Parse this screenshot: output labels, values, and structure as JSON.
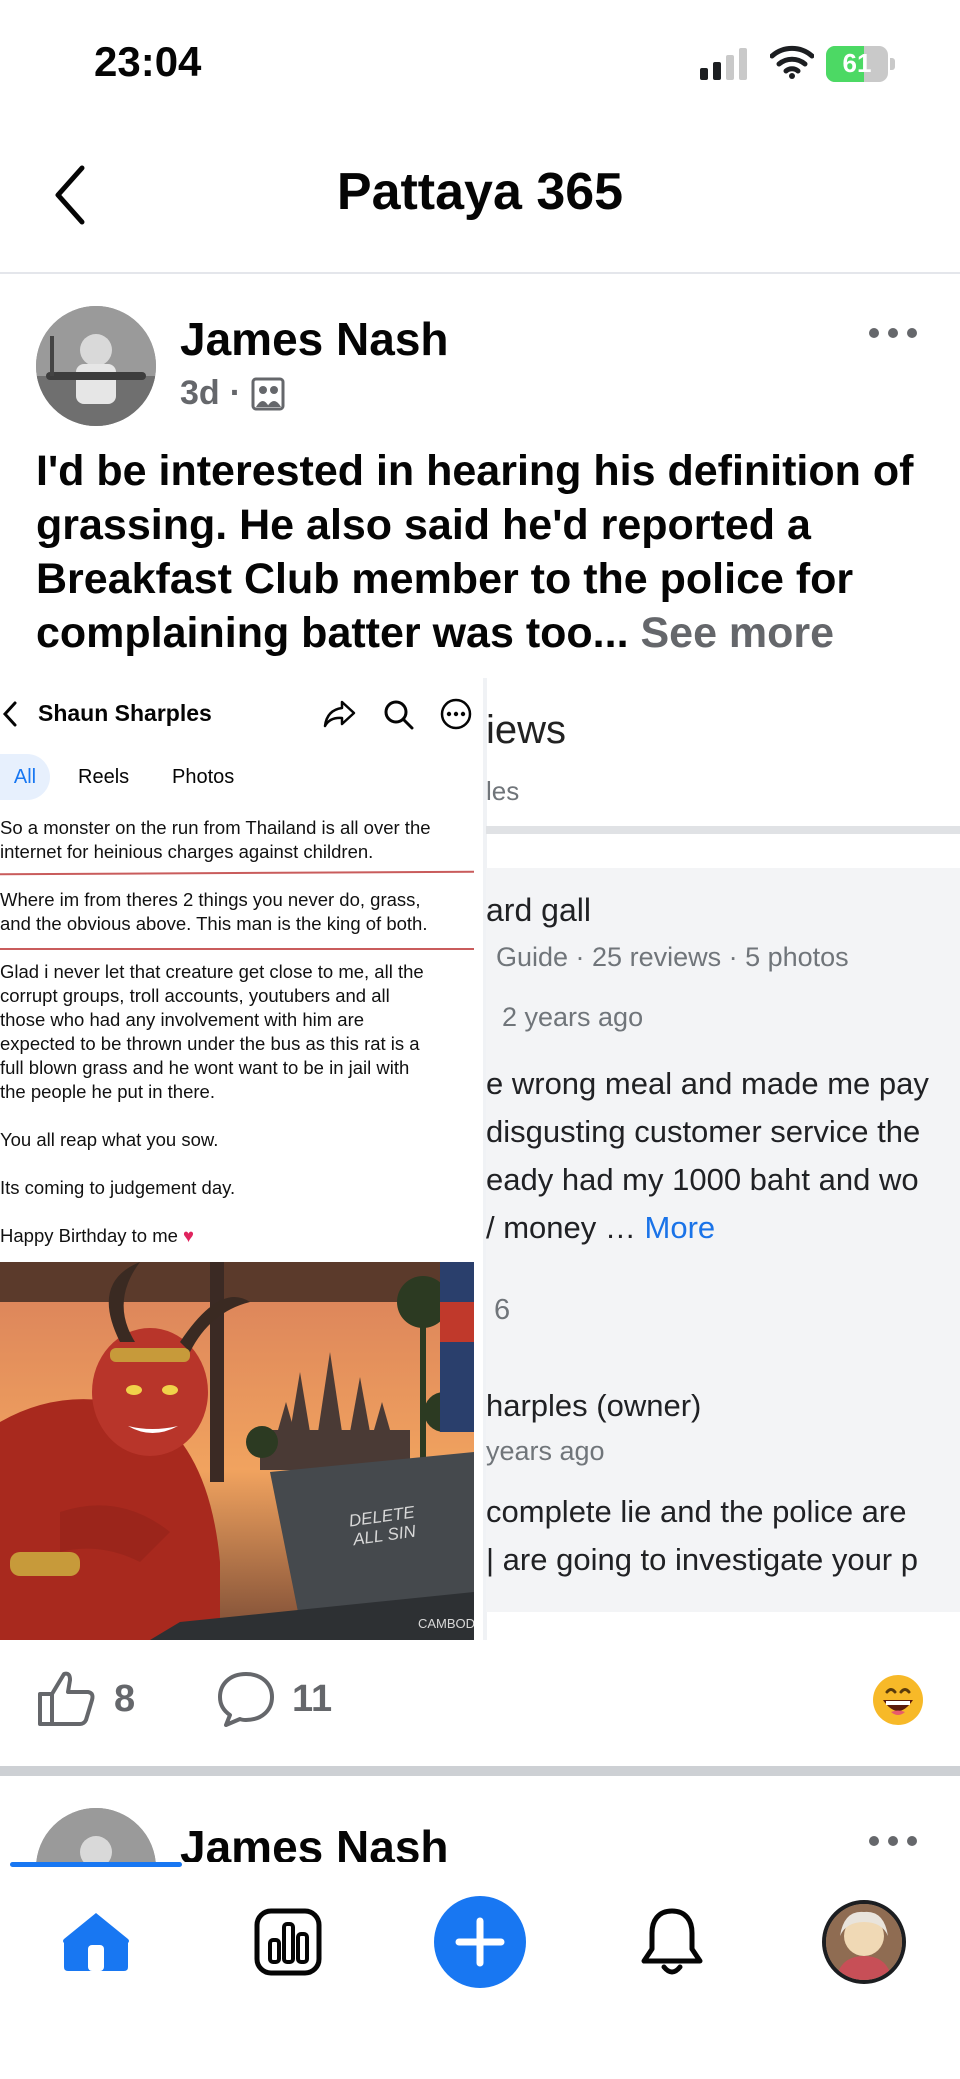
{
  "status_bar": {
    "time": "23:04",
    "battery": "61",
    "battery_level": 0.61
  },
  "header": {
    "title": "Pattaya 365"
  },
  "post": {
    "author": "James Nash",
    "age": "3d",
    "separator": "·",
    "text": "I'd be interested in hearing his definition of grassing. He also said he'd reported a Breakfast Club member to the police for complaining batter was too...",
    "see_more": "See more",
    "likes": "8",
    "comments": "11"
  },
  "screenshot_left": {
    "profile_name": "Shaun Sharples",
    "tabs": [
      "All",
      "Reels",
      "Photos"
    ],
    "lines": [
      "So a monster on the run from Thailand is all over the",
      "internet for heinious charges against children.",
      "Where im from theres 2 things you never do, grass,",
      "and the obvious above. This man is the king of both.",
      "Glad i never let that creature get close to me, all the",
      "corrupt groups, troll accounts, youtubers and all",
      "those who had any involvement with him are",
      "expected to be thrown under the bus as this rat is a",
      "full blown grass and he wont want to be in jail with",
      "the people he put in there.",
      "You all reap what you sow.",
      "Its coming to judgement day.",
      "Happy Birthday to me"
    ],
    "heart": "♥",
    "laptop_sticker": [
      "DELETE",
      "ALL SIN"
    ],
    "book_label": "CAMBOD"
  },
  "screenshot_right": {
    "title": "iews",
    "subtitle": "les",
    "reviewer": "ard gall",
    "reviewer_meta": "Guide · 25 reviews · 5 photos",
    "time": "2 years ago",
    "review_lines": [
      "e wrong meal and made me pay",
      "disgusting customer service the",
      "eady had my 1000 baht and wo",
      "/ money … "
    ],
    "more": "More",
    "likes": "6",
    "owner": "harples (owner)",
    "owner_time": "years ago",
    "owner_lines": [
      " complete lie and the police are",
      "| are going to investigate your p"
    ]
  },
  "next_post": {
    "author": "James Nash"
  },
  "colors": {
    "accent": "#1877f2",
    "secondary_text": "#65676b"
  },
  "icons": [
    "back-arrow-icon",
    "more-dots-icon",
    "photo-group-icon",
    "like-icon",
    "comment-icon",
    "grinning-emoji-icon",
    "home-icon",
    "stats-icon",
    "plus-icon",
    "bell-icon"
  ]
}
